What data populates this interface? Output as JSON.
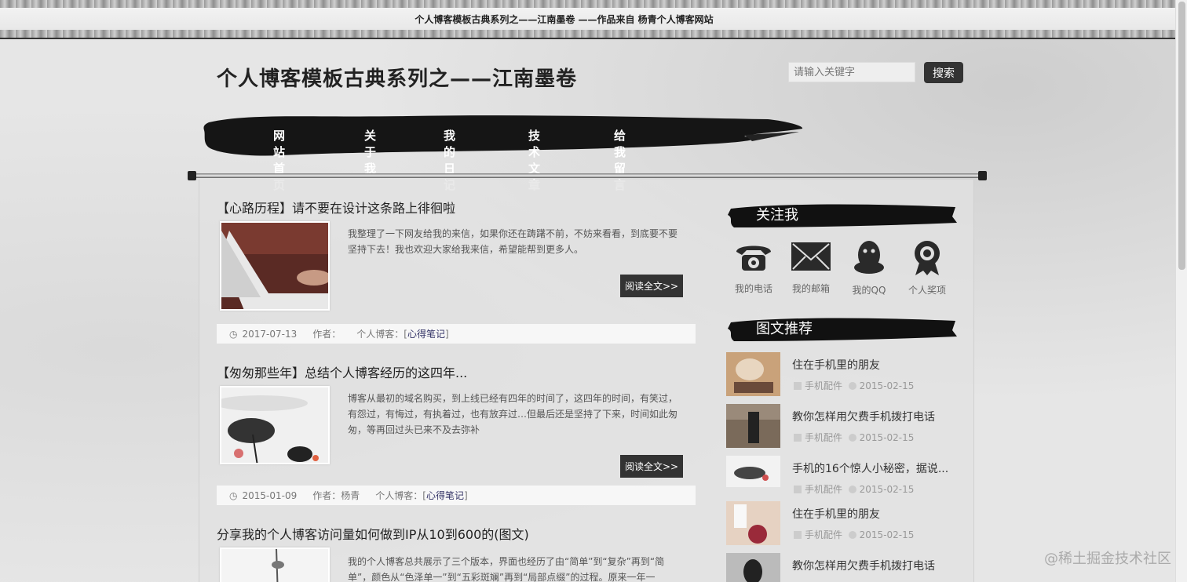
{
  "topbar": {
    "text": "个人博客模板古典系列之——江南墨卷 ——作品来自 杨青个人博客网站"
  },
  "header": {
    "title": "个人博客模板古典系列之——江南墨卷",
    "search_placeholder": "请输入关键字",
    "search_button": "搜索"
  },
  "nav": {
    "items": [
      "网站首页",
      "关于我",
      "我的日记",
      "技术文章",
      "给我留言"
    ]
  },
  "articles": [
    {
      "title": "【心路历程】请不要在设计这条路上徘徊啦",
      "desc": "我整理了一下网友给我的来信，如果你还在踌躇不前，不妨来看看，到底要不要坚持下去！我也欢迎大家给我来信，希望能帮到更多人。",
      "read_more": "阅读全文>>",
      "date": "2017-07-13",
      "author_label": "作者：",
      "author": "",
      "category_label": "个人博客：[",
      "category": "心得笔记",
      "category_end": "]"
    },
    {
      "title": "【匆匆那些年】总结个人博客经历的这四年...",
      "desc": "博客从最初的域名购买，到上线已经有四年的时间了，这四年的时间，有笑过，有怨过，有悔过，有执着过，也有放弃过…但最后还是坚持了下来，时间如此匆匆，等再回过头已来不及去弥补",
      "read_more": "阅读全文>>",
      "date": "2015-01-09",
      "author_label": "作者：",
      "author": "杨青",
      "category_label": "个人博客：[",
      "category": "心得笔记",
      "category_end": "]"
    },
    {
      "title": "分享我的个人博客访问量如何做到IP从10到600的(图文)",
      "desc": "我的个人博客总共展示了三个版本，界面也经历了由“简单”到“复杂”再到“简单”，颜色从“色泽单一”到“五彩斑斓”再到“局部点缀”的过程。原来一年一"
    }
  ],
  "sidebar": {
    "follow_title": "关注我",
    "follow": [
      {
        "label": "我的电话",
        "icon": "phone-icon"
      },
      {
        "label": "我的邮箱",
        "icon": "mail-icon"
      },
      {
        "label": "我的QQ",
        "icon": "qq-penguin-icon"
      },
      {
        "label": "个人奖项",
        "icon": "award-icon"
      }
    ],
    "rec_title": "图文推荐",
    "recommendations": [
      {
        "title": "住在手机里的朋友",
        "category": "手机配件",
        "date": "2015-02-15"
      },
      {
        "title": "教你怎样用欠费手机拨打电话",
        "category": "手机配件",
        "date": "2015-02-15"
      },
      {
        "title": "手机的16个惊人小秘密，据说...",
        "category": "手机配件",
        "date": "2015-02-15"
      },
      {
        "title": "住在手机里的朋友",
        "category": "手机配件",
        "date": "2015-02-15"
      },
      {
        "title": "教你怎样用欠费手机拨打电话",
        "category": "",
        "date": ""
      }
    ]
  },
  "watermark": "@稀土掘金技术社区"
}
